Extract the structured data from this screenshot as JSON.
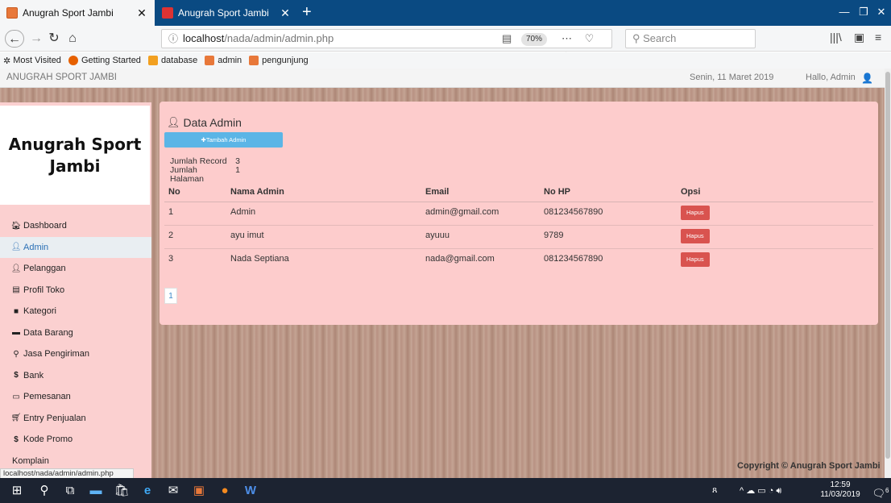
{
  "browser": {
    "tabs": [
      {
        "title": "Anugrah Sport Jambi",
        "active": true
      },
      {
        "title": "Anugrah Sport Jambi",
        "active": false
      }
    ],
    "url_host": "localhost",
    "url_path": "/nada/admin/admin.php",
    "zoom": "70%",
    "search_placeholder": "Search",
    "bookmarks": [
      "Most Visited",
      "Getting Started",
      "database",
      "admin",
      "pengunjung"
    ],
    "status_link": "localhost/nada/admin/admin.php"
  },
  "topbar": {
    "brand": "ANUGRAH SPORT JAMBI",
    "date": "Senin, 11 Maret 2019",
    "greeting": "Hallo, Admin"
  },
  "sidebar": {
    "brand": "Anugrah Sport Jambi",
    "items": [
      {
        "label": "Dashboard",
        "icon": "home-icon"
      },
      {
        "label": "Admin",
        "icon": "user-icon",
        "active": true
      },
      {
        "label": "Pelanggan",
        "icon": "user-icon"
      },
      {
        "label": "Profil Toko",
        "icon": "list-icon"
      },
      {
        "label": "Kategori",
        "icon": "book-icon"
      },
      {
        "label": "Data Barang",
        "icon": "folder-icon"
      },
      {
        "label": "Jasa Pengiriman",
        "icon": "map-marker-icon"
      },
      {
        "label": "Bank",
        "icon": "dollar-icon"
      },
      {
        "label": "Pemesanan",
        "icon": "comment-icon"
      },
      {
        "label": "Entry Penjualan",
        "icon": "cart-icon"
      },
      {
        "label": "Kode Promo",
        "icon": "dollar-icon"
      },
      {
        "label": "Komplain",
        "icon": ""
      }
    ]
  },
  "main": {
    "title": "Data Admin",
    "add_button": "Tambah Admin",
    "stats": [
      {
        "label": "Jumlah Record",
        "value": "3"
      },
      {
        "label": "Jumlah Halaman",
        "value": "1"
      }
    ],
    "table": {
      "columns": [
        "No",
        "Nama Admin",
        "Email",
        "No HP",
        "Opsi"
      ],
      "rows": [
        {
          "no": "1",
          "nama": "Admin",
          "email": "admin@gmail.com",
          "hp": "081234567890",
          "action": "Hapus"
        },
        {
          "no": "2",
          "nama": "ayu imut",
          "email": "ayuuu",
          "hp": "9789",
          "action": "Hapus"
        },
        {
          "no": "3",
          "nama": "Nada Septiana",
          "email": "nada@gmail.com",
          "hp": "081234567890",
          "action": "Hapus"
        }
      ]
    },
    "pagination": [
      "1"
    ]
  },
  "footer": {
    "copyright": "Copyright © Anugrah Sport Jambi"
  },
  "taskbar": {
    "time": "12:59",
    "date": "11/03/2019",
    "notifications": "6"
  },
  "colors": {
    "panel_bg": "#fdcccc",
    "sidebar_bg": "#fbd0d0",
    "add_button": "#5bb5e6",
    "danger": "#d9534f",
    "tabbar": "#0a4a82"
  }
}
